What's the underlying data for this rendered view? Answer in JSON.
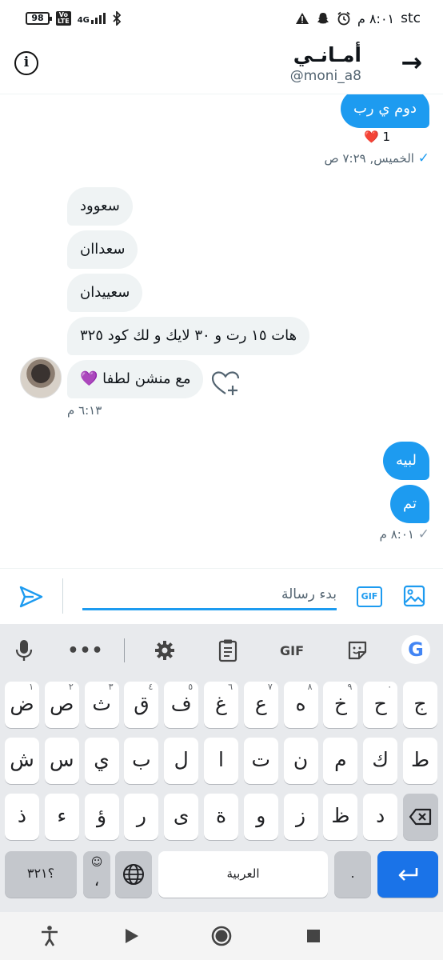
{
  "status_bar": {
    "battery": "98",
    "volte": "Vo\nLTE",
    "network": "4G",
    "time": "٨:٠١ م",
    "carrier": "stc"
  },
  "header": {
    "title": "أمـانـي",
    "handle": "@moni_a8",
    "info_icon": "i",
    "back_icon": "→"
  },
  "conversation": {
    "first_out_text": "دوم ي رب",
    "like_count": "1",
    "first_out_time": "الخميس, ٧:٢٩ ص",
    "incoming": [
      "سعوود",
      "سعداان",
      "سعييدان",
      "هات ١٥ رت و ٣٠ لايك و لك كود ٣٢٥",
      "مع منشن لطفا 💜"
    ],
    "incoming_time": "٦:١٣ م",
    "outgoing": [
      "لبيه",
      "تم"
    ],
    "outgoing_time": "٨:٠١ م"
  },
  "composer": {
    "placeholder": "بدء رسالة",
    "gif_label": "GIF"
  },
  "keyboard": {
    "toolbar_gif": "GIF",
    "toolbar_google": "G",
    "row1": [
      {
        "k": "ض",
        "h": "١"
      },
      {
        "k": "ص",
        "h": "٢"
      },
      {
        "k": "ث",
        "h": "٣"
      },
      {
        "k": "ق",
        "h": "٤"
      },
      {
        "k": "ف",
        "h": "٥"
      },
      {
        "k": "غ",
        "h": "٦"
      },
      {
        "k": "ع",
        "h": "٧"
      },
      {
        "k": "ه",
        "h": "٨"
      },
      {
        "k": "خ",
        "h": "٩"
      },
      {
        "k": "ح",
        "h": "٠"
      },
      {
        "k": "ج",
        "h": ""
      }
    ],
    "row2": [
      "ش",
      "س",
      "ي",
      "ب",
      "ل",
      "ا",
      "ت",
      "ن",
      "م",
      "ك",
      "ط"
    ],
    "row3": [
      "ذ",
      "ء",
      "ؤ",
      "ر",
      "ى",
      "ة",
      "و",
      "ز",
      "ظ",
      "د"
    ],
    "symbols_key": "؟٣٢١",
    "emoji_comma": "،",
    "space_label": "العربية",
    "period_key": "."
  },
  "colors": {
    "accent": "#1d9bf0",
    "bubble_in": "#eff3f4",
    "keyboard_bg": "#e8eaed",
    "enter_key": "#1a73e8"
  }
}
